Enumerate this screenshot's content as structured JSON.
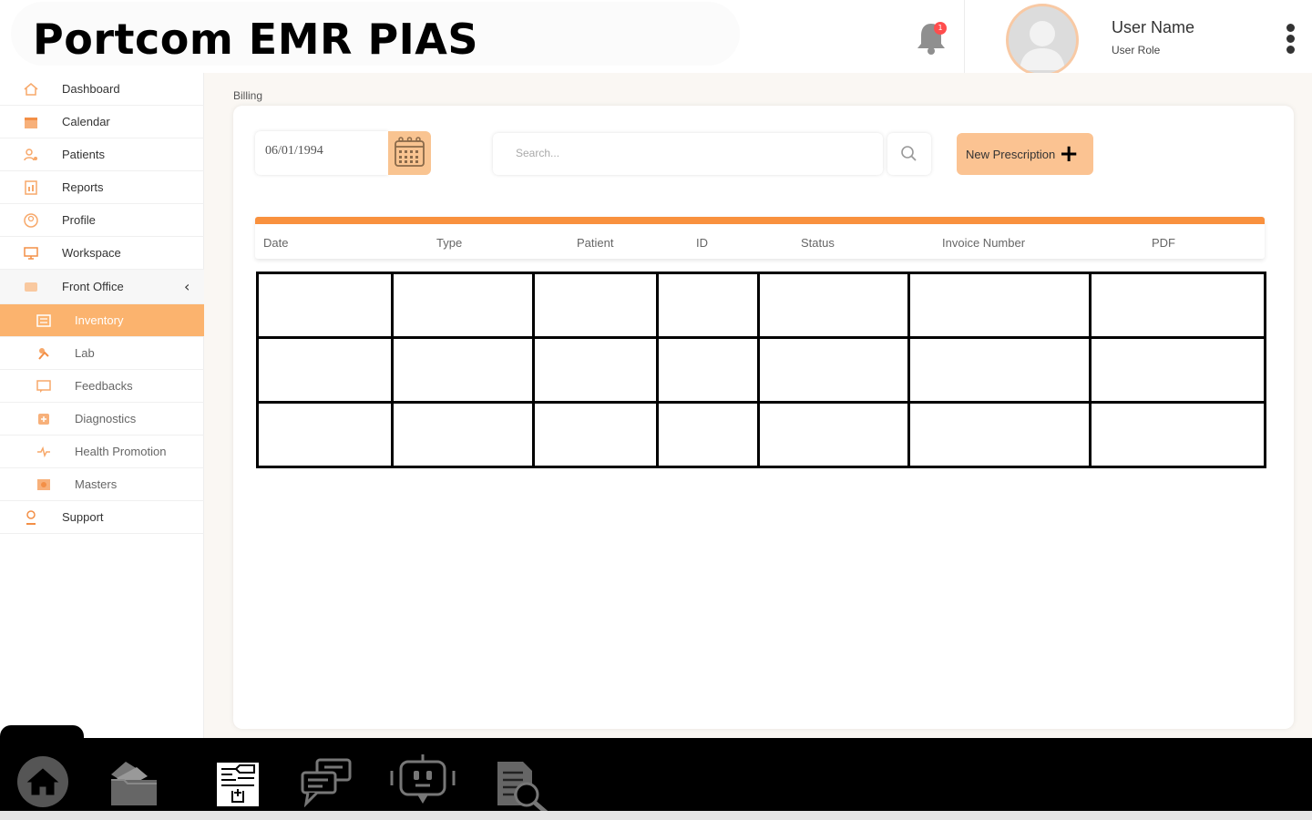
{
  "header": {
    "app_title": "Portcom EMR PIAS",
    "notification_count": "1",
    "user_name": "User Name",
    "user_role": "User Role"
  },
  "sidebar": {
    "items": [
      {
        "label": "Dashboard",
        "icon": "home-icon"
      },
      {
        "label": "Calendar",
        "icon": "calendar-icon"
      },
      {
        "label": "Patients",
        "icon": "patients-icon"
      },
      {
        "label": "Reports",
        "icon": "reports-icon"
      },
      {
        "label": "Profile",
        "icon": "profile-icon"
      },
      {
        "label": "Workspace",
        "icon": "monitor-icon"
      },
      {
        "label": "Front Office",
        "icon": "front-office-icon",
        "expanded": true
      },
      {
        "label": "Inventory",
        "icon": "inventory-icon",
        "active": true
      },
      {
        "label": "Lab",
        "icon": "lab-icon"
      },
      {
        "label": "Feedbacks",
        "icon": "feedback-icon"
      },
      {
        "label": "Diagnostics",
        "icon": "diagnostics-icon"
      },
      {
        "label": "Health Promotion",
        "icon": "health-promotion-icon"
      },
      {
        "label": "Masters",
        "icon": "masters-icon"
      },
      {
        "label": "Support",
        "icon": "support-icon"
      }
    ]
  },
  "main": {
    "breadcrumb": "Billing",
    "date_value": "06/01/1994",
    "search_placeholder": "Search...",
    "new_prescription_label": "New Prescription",
    "table": {
      "columns": [
        "Date",
        "Type",
        "Patient",
        "ID",
        "Status",
        "Invoice Number",
        "PDF"
      ],
      "rows": [
        [
          "",
          "",
          "",
          "",
          "",
          "",
          ""
        ],
        [
          "",
          "",
          "",
          "",
          "",
          "",
          ""
        ],
        [
          "",
          "",
          "",
          "",
          "",
          "",
          ""
        ]
      ]
    }
  },
  "bottom_bar": {
    "icons": [
      "home-icon",
      "documents-icon",
      "prescription-icon",
      "chat-icon",
      "bot-icon",
      "document-search-icon"
    ]
  },
  "colors": {
    "accent": "#f9913e",
    "accent_light": "#fbc392",
    "active_nav": "#fbb36e",
    "background": "#faf7f3"
  }
}
